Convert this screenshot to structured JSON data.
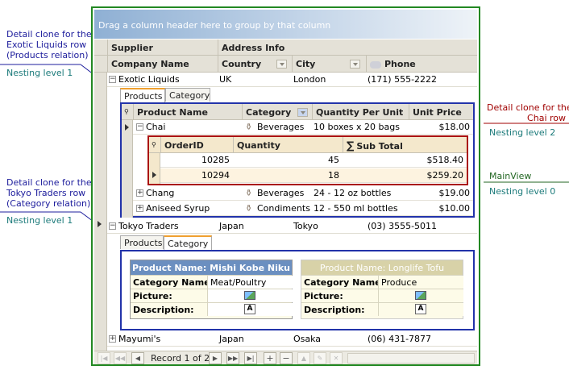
{
  "callouts": {
    "exotic": "Detail clone for the\nExotic Liquids row\n(Products relation)",
    "exotic_level": "Nesting level 1",
    "tokyo": "Detail clone for the\nTokyo Traders row\n(Category relation)",
    "tokyo_level": "Nesting level 1",
    "chai": "Detail clone for the\nChai row",
    "chai_level": "Nesting level 2",
    "main": "MainView",
    "main_level": "Nesting level 0"
  },
  "grid": {
    "group_panel": "Drag a column header here to group by that column",
    "bands": [
      "Supplier",
      "Address Info"
    ],
    "columns": [
      "Company Name",
      "Country",
      "City",
      "Phone"
    ],
    "rows": [
      {
        "company": "Exotic Liquids",
        "country": "UK",
        "city": "London",
        "phone": "(171) 555-2222"
      },
      {
        "company": "Tokyo Traders",
        "country": "Japan",
        "city": "Tokyo",
        "phone": "(03) 3555-5011"
      },
      {
        "company": "Mayumi's",
        "country": "Japan",
        "city": "Osaka",
        "phone": "(06) 431-7877"
      }
    ]
  },
  "products_detail": {
    "tabs": [
      "Products",
      "Category"
    ],
    "columns": [
      "Product Name",
      "Category",
      "Quantity Per Unit",
      "Unit Price"
    ],
    "rows": [
      {
        "name": "Chai",
        "category": "Beverages",
        "qty": "10 boxes x 20 bags",
        "price": "$18.00"
      },
      {
        "name": "Chang",
        "category": "Beverages",
        "qty": "24 - 12 oz bottles",
        "price": "$19.00"
      },
      {
        "name": "Aniseed Syrup",
        "category": "Condiments",
        "qty": "12 - 550 ml bottles",
        "price": "$10.00"
      }
    ]
  },
  "orders_detail": {
    "columns": [
      "OrderID",
      "Quantity",
      "Sub Total"
    ],
    "sum_symbol": "∑",
    "rows": [
      {
        "id": "10285",
        "qty": "45",
        "subtotal": "$518.40"
      },
      {
        "id": "10294",
        "qty": "18",
        "subtotal": "$259.20"
      }
    ]
  },
  "category_detail": {
    "tabs": [
      "Products",
      "Category"
    ],
    "cards": [
      {
        "title": "Product Name: Mishi Kobe Niku",
        "category_label": "Category Name:",
        "category": "Meat/Poultry",
        "picture_label": "Picture:",
        "description_label": "Description:"
      },
      {
        "title": "Product Name: Longlife Tofu",
        "category_label": "Category Name:",
        "category": "Produce",
        "picture_label": "Picture:",
        "description_label": "Description:"
      }
    ]
  },
  "navigator": {
    "record_text": "Record 1 of 2"
  },
  "colors": {
    "main_border": "#228822",
    "detail_border": "#2233aa",
    "orders_border": "#aa1111",
    "card_active_header": "#6b8fc0",
    "card_inactive_header": "#d8d2a8"
  }
}
